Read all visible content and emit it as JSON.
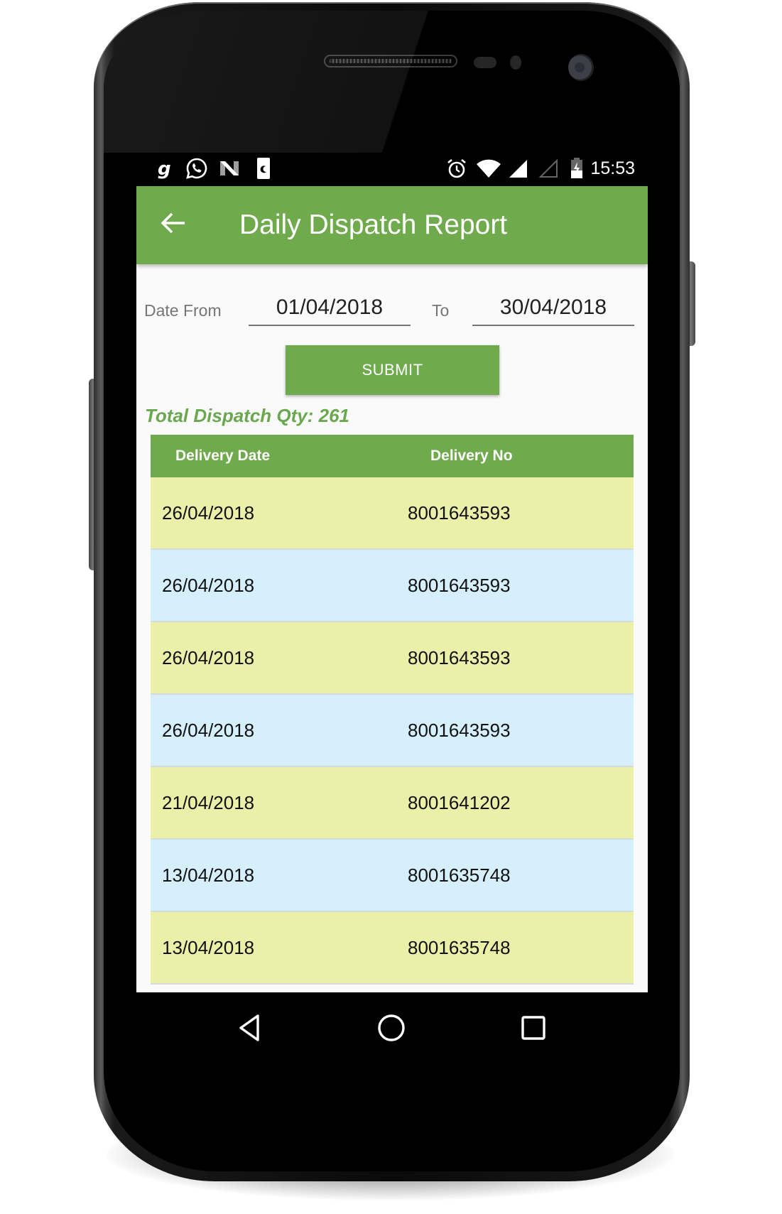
{
  "status_bar": {
    "left_icons": [
      "g-app-icon",
      "whatsapp-icon",
      "n-app-icon",
      "do-not-disturb-card-icon"
    ],
    "right_icons": [
      "alarm-icon",
      "wifi-icon",
      "signal-full-icon",
      "signal-empty-icon",
      "battery-charging-icon"
    ],
    "time": "15:53"
  },
  "app_bar": {
    "back_icon": "arrow-left-icon",
    "title": "Daily Dispatch Report",
    "color": "#6faa4c"
  },
  "filter": {
    "from_label": "Date From",
    "from_value": "01/04/2018",
    "to_label": "To",
    "to_value": "30/04/2018",
    "submit_label": "SUBMIT"
  },
  "summary": {
    "total_label": "Total Dispatch Qty: 261"
  },
  "table": {
    "headers": [
      "Delivery Date",
      "Delivery No"
    ],
    "rows": [
      {
        "date": "26/04/2018",
        "number": "8001643593"
      },
      {
        "date": "26/04/2018",
        "number": "8001643593"
      },
      {
        "date": "26/04/2018",
        "number": "8001643593"
      },
      {
        "date": "26/04/2018",
        "number": "8001643593"
      },
      {
        "date": "21/04/2018",
        "number": "8001641202"
      },
      {
        "date": "13/04/2018",
        "number": "8001635748"
      },
      {
        "date": "13/04/2018",
        "number": "8001635748"
      }
    ],
    "row_colors": [
      "#eaf0a8",
      "#d5f0fc"
    ]
  },
  "nav_bar": {
    "buttons": [
      "back-triangle-icon",
      "home-circle-icon",
      "recents-square-icon"
    ]
  }
}
